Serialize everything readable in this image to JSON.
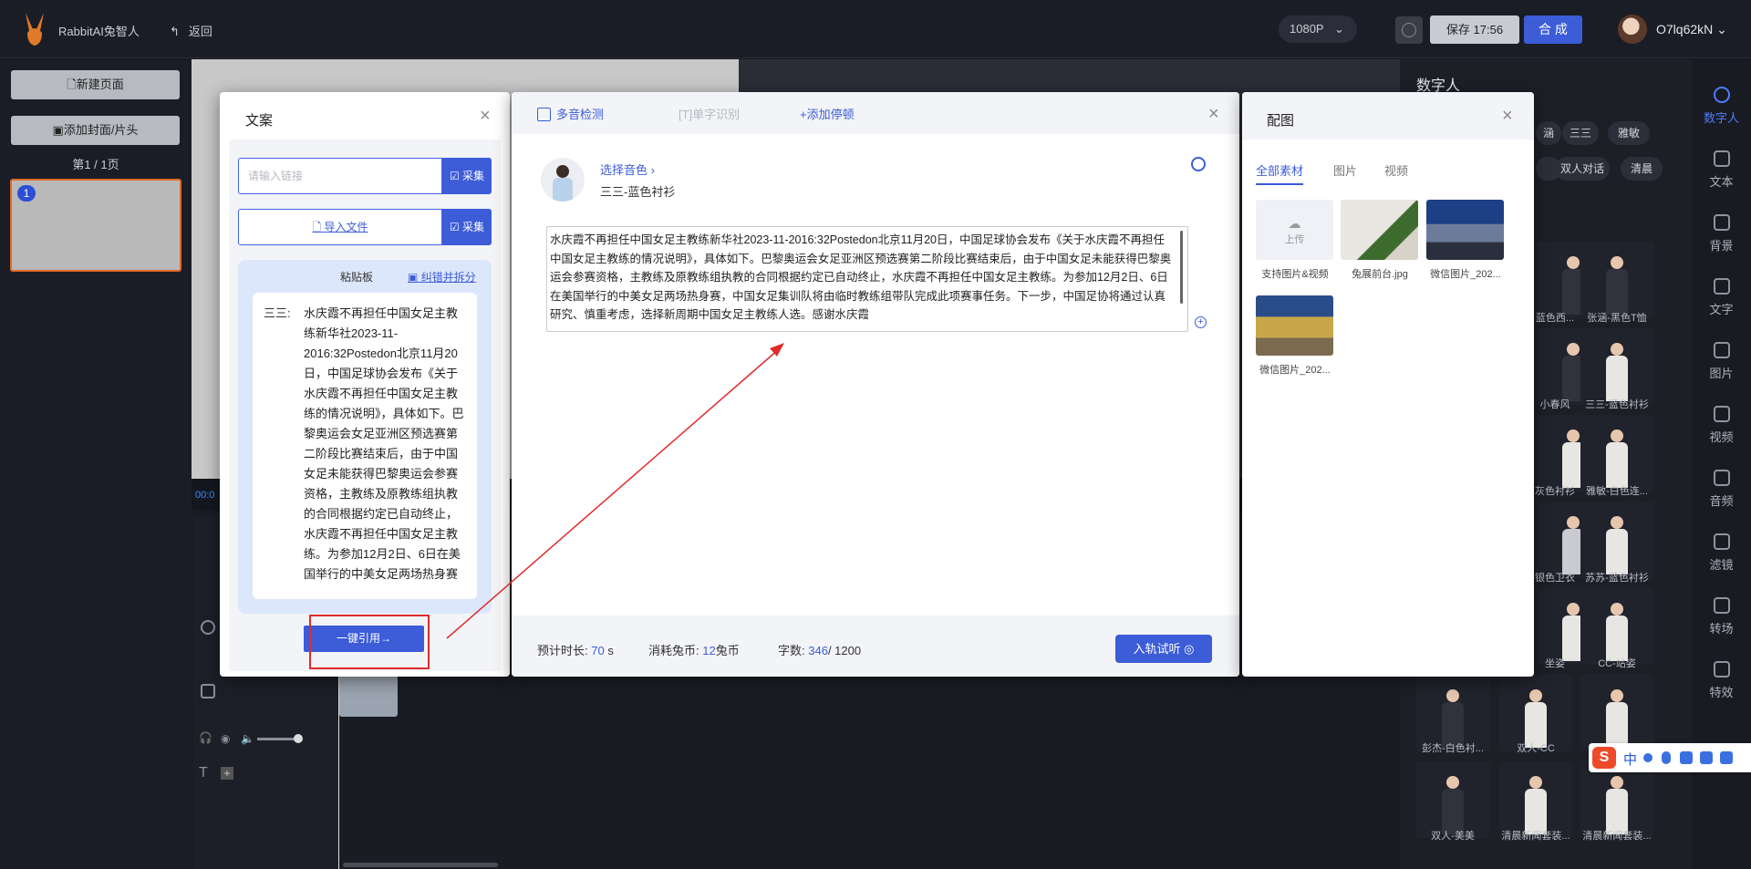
{
  "topbar": {
    "brand": "RabbitAI兔智人",
    "back_label": "返回",
    "resolution": "1080P",
    "save_label": "保存 17:56",
    "compose_label": "合 成",
    "username": "O7lq62kN"
  },
  "left_sidebar": {
    "new_page": "新建页面",
    "add_cover": "添加封面/片头",
    "page_count": "第1 / 1页",
    "thumb_number": "1"
  },
  "timeline": {
    "time_fragment": "00:0"
  },
  "wenan_panel": {
    "title": "文案",
    "link_placeholder": "请输入链接",
    "collect_label": "采集",
    "import_label": "导入文件",
    "paste_title": "粘贴板",
    "correct_label": "纠错并拆分",
    "speaker": "三三:",
    "paste_text": "水庆霞不再担任中国女足主教练新华社2023-11-2016:32Postedon北京11月20日，中国足球协会发布《关于水庆霞不再担任中国女足主教练的情况说明》，具体如下。巴黎奥运会女足亚洲区预选赛第二阶段比赛结束后，由于中国女足未能获得巴黎奥运会参赛资格，主教练及原教练组执教的合同根据约定已自动终止，水庆霞不再担任中国女足主教练。为参加12月2日、6日在美国举行的中美女足两场热身赛",
    "quote_label": "一键引用→"
  },
  "editor_panel": {
    "polyphone_label": "多音检测",
    "single_word_label": "单字识别",
    "add_pause_label": "+添加停顿",
    "choose_voice": "选择音色 ›",
    "voice_name": "三三-蓝色衬衫",
    "script_text": "水庆霞不再担任中国女足主教练新华社2023-11-2016:32Postedon北京11月20日，中国足球协会发布《关于水庆霞不再担任中国女足主教练的情况说明》，具体如下。巴黎奥运会女足亚洲区预选赛第二阶段比赛结束后，由于中国女足未能获得巴黎奥运会参赛资格，主教练及原教练组执教的合同根据约定已自动终止，水庆霞不再担任中国女足主教练。为参加12月2日、6日在美国举行的中美女足两场热身赛，中国女足集训队将由临时教练组带队完成此项赛事任务。下一步，中国足协将通过认真研究、慎重考虑，选择新周期中国女足主教练人选。感谢水庆霞",
    "duration_label": "预计时长:",
    "duration_value": "70",
    "duration_unit": "s",
    "coins_label": "消耗兔币:",
    "coins_value": "12",
    "coins_unit": "兔币",
    "chars_label": "字数:",
    "chars_value": "346",
    "chars_max": "/ 1200",
    "trial_label": "入轨试听"
  },
  "peitu_panel": {
    "title": "配图",
    "tabs": [
      "全部素材",
      "图片",
      "视频"
    ],
    "upload_label": "上传",
    "upload_caption": "支持图片&视频",
    "items": [
      "兔展前台.jpg",
      "微信图片_202...",
      "微信图片_202..."
    ]
  },
  "digital_human_panel": {
    "title": "数字人",
    "chips": [
      "涵",
      "三三",
      "雅敏",
      "",
      "双人对话",
      "清晨"
    ],
    "labels": [
      "蓝色西...",
      "张涵-黑色T恤",
      "小春风",
      "三三-蓝色衬衫",
      "灰色衬衫",
      "雅敏-白色连...",
      "银色卫衣",
      "苏苏-蓝色衬衫",
      "坐姿",
      "CC-站姿",
      "彭杰-白色衬...",
      "双人-CC",
      "双人-美美",
      "清晨新闻套装...",
      "清晨新闻套装..."
    ]
  },
  "right_rail": {
    "items": [
      "数字人",
      "文本",
      "背景",
      "文字",
      "图片",
      "视频",
      "音频",
      "滤镜",
      "转场",
      "特效"
    ]
  },
  "ime": {
    "label": "中"
  }
}
